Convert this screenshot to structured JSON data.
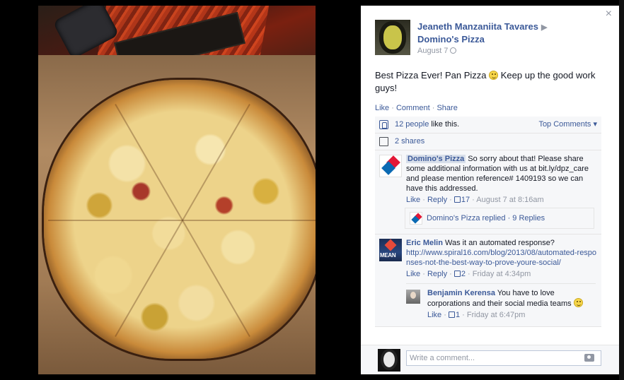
{
  "photo": {
    "alt_name": "pizza-photo"
  },
  "post": {
    "author": "Jeaneth Manzaniita Tavares",
    "arrow": "▶",
    "target": "Domino's Pizza",
    "date": "August 7",
    "text_before": "Best Pizza Ever! Pan Pizza ",
    "text_after": " Keep up the good work guys!",
    "actions": {
      "like": "Like",
      "comment": "Comment",
      "share": "Share",
      "sep": "·"
    }
  },
  "ufi": {
    "likes_link": "12 people",
    "likes_rest": " like this.",
    "top_comments": "Top Comments ▾",
    "shares": "2 shares"
  },
  "comments": [
    {
      "author": "Domino's Pizza",
      "text": " So sorry about that! Please share some additional information with us at bit.ly/dpz_care and please mention reference# 1409193 so we can have this addressed.",
      "like": "Like",
      "reply": "Reply",
      "count": "17",
      "time": "August 7 at 8:16am",
      "replied_text": "Domino's Pizza replied · 9 Replies"
    },
    {
      "author": "Eric Melin",
      "text": " Was it an automated response?",
      "link": "http://www.spiral16.com/blog/2013/08/automated-responses-not-the-best-way-to-prove-youre-social/",
      "like": "Like",
      "reply": "Reply",
      "count": "2",
      "time": "Friday at 4:34pm",
      "avatar_text": "MEAN",
      "reply_item": {
        "author": "Benjamin Kerensa",
        "text": " You have to love corporations and their social media teams ",
        "like": "Like",
        "count": "1",
        "time": "Friday at 6:47pm"
      }
    }
  ],
  "composer": {
    "placeholder": "Write a comment..."
  },
  "close_label": "×"
}
